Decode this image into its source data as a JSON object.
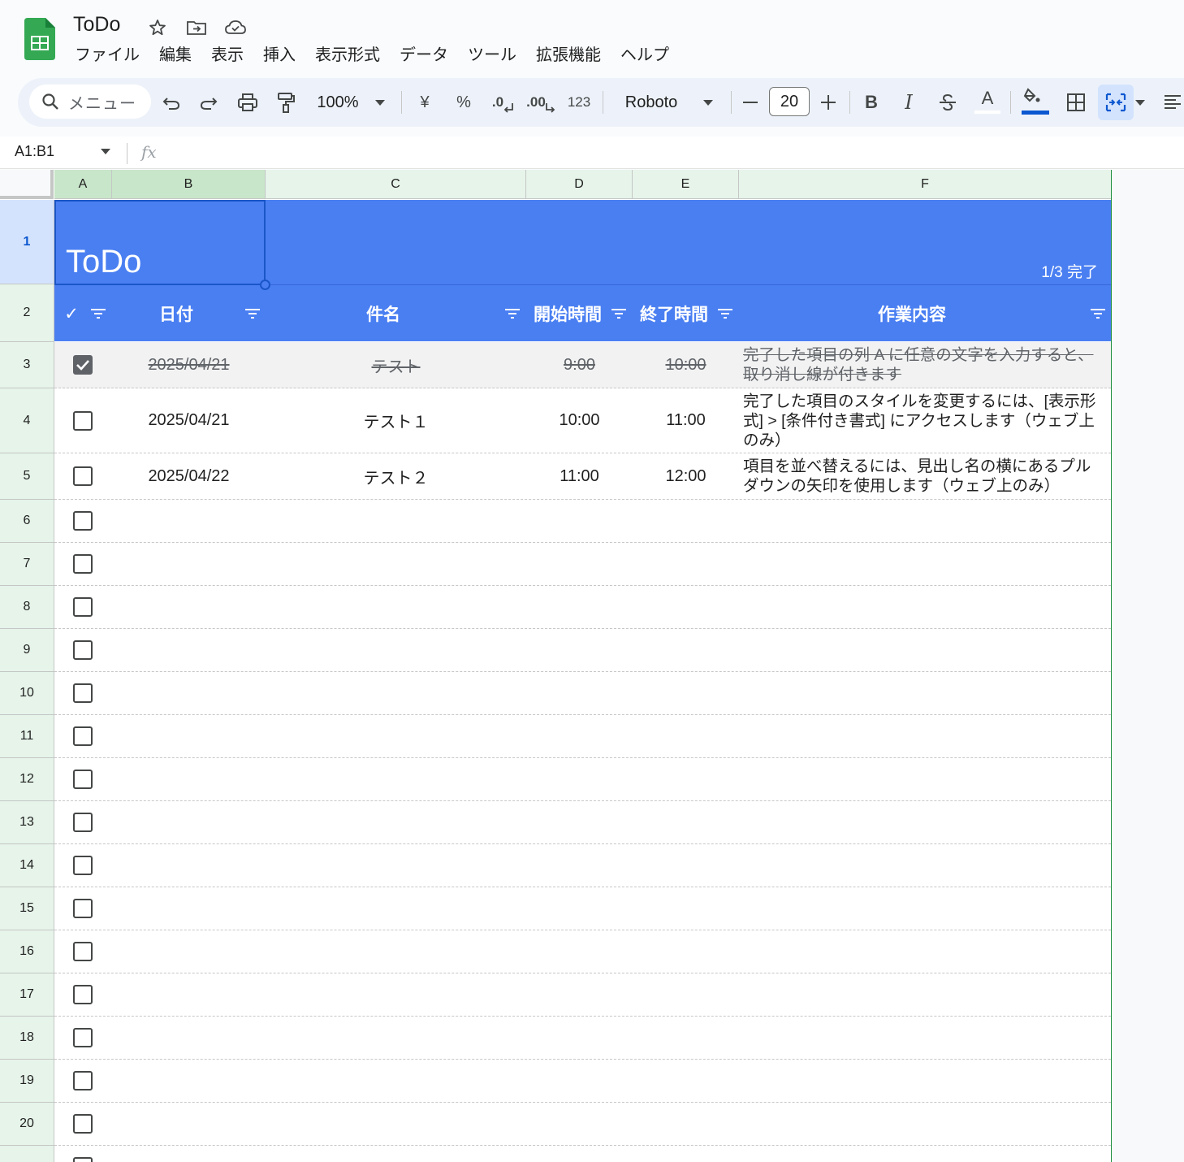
{
  "app": {
    "doc_title": "ToDo",
    "menu": [
      "ファイル",
      "編集",
      "表示",
      "挿入",
      "表示形式",
      "データ",
      "ツール",
      "拡張機能",
      "ヘルプ"
    ]
  },
  "toolbar": {
    "search_label": "メニュー",
    "zoom": "100%",
    "currency": "¥",
    "percent": "%",
    "dec_decrease": ".0",
    "dec_increase": ".00",
    "number_format": "123",
    "font": "Roboto",
    "font_size": "20",
    "bold": "B",
    "italic": "I",
    "text_color": "A",
    "accent_color": "#0b57d0"
  },
  "formula_bar": {
    "name_box": "A1:B1",
    "fx": "fx"
  },
  "columns": [
    "A",
    "B",
    "C",
    "D",
    "E",
    "F"
  ],
  "rows": [
    "1",
    "2",
    "3",
    "4",
    "5",
    "6",
    "7",
    "8",
    "9",
    "10",
    "11",
    "12",
    "13",
    "14",
    "15",
    "16",
    "17",
    "18",
    "19",
    "20"
  ],
  "sheet": {
    "title": "ToDo",
    "status": "1/3 完了",
    "headers": {
      "check": "✓",
      "date": "日付",
      "subject": "件名",
      "start": "開始時間",
      "end": "終了時間",
      "detail": "作業内容"
    },
    "tasks": [
      {
        "done": true,
        "date": "2025/04/21",
        "subject": "テスト",
        "start": "9:00",
        "end": "10:00",
        "detail": "完了した項目の列 A に任意の文字を入力すると、取り消し線が付きます"
      },
      {
        "done": false,
        "date": "2025/04/21",
        "subject": "テスト１",
        "start": "10:00",
        "end": "11:00",
        "detail": "完了した項目のスタイルを変更するには、[表示形式] > [条件付き書式] にアクセスします（ウェブ上のみ）"
      },
      {
        "done": false,
        "date": "2025/04/22",
        "subject": "テスト２",
        "start": "11:00",
        "end": "12:00",
        "detail": "項目を並べ替えるには、見出し名の横にあるプルダウンの矢印を使用します（ウェブ上のみ）"
      }
    ],
    "header_color": "#4a7ff2"
  }
}
